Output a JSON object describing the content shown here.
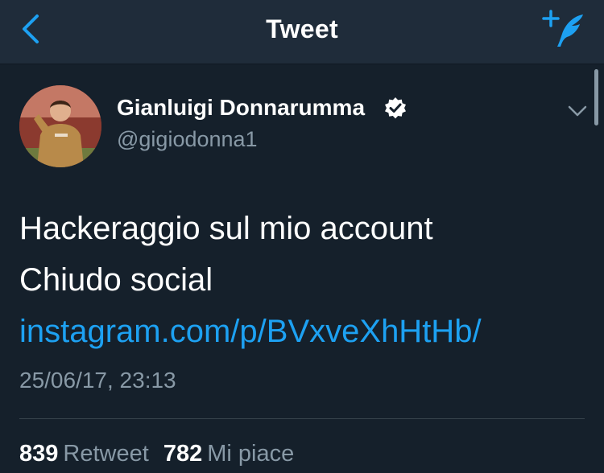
{
  "header": {
    "title": "Tweet",
    "back_icon": "chevron-left-icon",
    "compose_icon": "compose-tweet-icon",
    "accent_color": "#1da1f2"
  },
  "tweet": {
    "author": {
      "display_name": "Gianluigi Donnarumma",
      "handle": "@gigiodonna1",
      "verified": true
    },
    "text_lines": {
      "line1": "Hackeraggio sul mio account",
      "line2_text": "Chiudo social ",
      "link": "instagram.com/p/BVxveXhHtHb/"
    },
    "timestamp": "25/06/17, 23:13",
    "stats": {
      "retweets_count": "839",
      "retweets_label": "Retweet",
      "likes_count": "782",
      "likes_label": "Mi piace"
    }
  },
  "colors": {
    "background": "#15202b",
    "navbar": "#1f2c3a",
    "secondary_text": "#8899a6",
    "link": "#1da1f2"
  }
}
